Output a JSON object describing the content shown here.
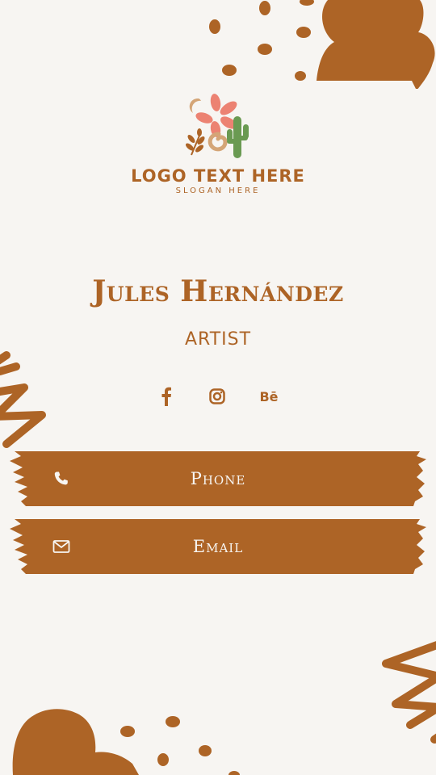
{
  "colors": {
    "background": "#f7f5f2",
    "accent": "#ad6426",
    "coral": "#ec8272",
    "cactus": "#6a9a52",
    "sand": "#d4a577",
    "button_text": "#f7f5f2"
  },
  "logo": {
    "text": "LOGO TEXT HERE",
    "slogan": "SLOGAN HERE",
    "icon": "desert-flower-cactus-icon"
  },
  "profile": {
    "name": "Jules Hernández",
    "role": "ARTIST"
  },
  "socials": [
    {
      "icon": "facebook-icon",
      "label": "f"
    },
    {
      "icon": "instagram-icon"
    },
    {
      "icon": "behance-icon",
      "label": "Bē"
    }
  ],
  "buttons": {
    "phone": {
      "label": "Phone",
      "icon": "phone-icon"
    },
    "email": {
      "label": "Email",
      "icon": "mail-icon"
    }
  }
}
